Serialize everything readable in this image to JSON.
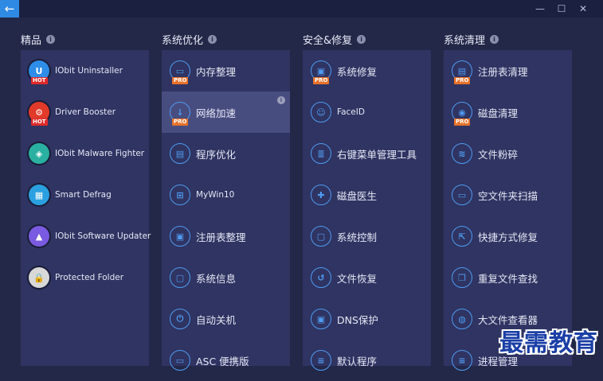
{
  "titlebar": {
    "back_glyph": "←",
    "minimize": "—",
    "maximize": "☐",
    "close": "✕"
  },
  "sections": [
    {
      "title": "精品",
      "info": "i"
    },
    {
      "title": "系统优化",
      "info": "i"
    },
    {
      "title": "安全&修复",
      "info": "i"
    },
    {
      "title": "系统清理",
      "info": "i"
    }
  ],
  "columns": [
    [
      {
        "label": "IObit Uninstaller",
        "badge": "HOT",
        "icon": "uninstaller-icon"
      },
      {
        "label": "Driver Booster",
        "badge": "HOT",
        "icon": "driver-booster-icon"
      },
      {
        "label": "IObit Malware Fighter",
        "badge": "",
        "icon": "malware-fighter-icon"
      },
      {
        "label": "Smart Defrag",
        "badge": "",
        "icon": "smart-defrag-icon"
      },
      {
        "label": "IObit Software Updater",
        "badge": "",
        "icon": "software-updater-icon"
      },
      {
        "label": "Protected Folder",
        "badge": "",
        "icon": "protected-folder-icon"
      }
    ],
    [
      {
        "label": "内存整理",
        "badge": "PRO",
        "icon": "memory-icon"
      },
      {
        "label": "网络加速",
        "badge": "PRO",
        "icon": "network-download-icon",
        "selected": true,
        "info": "i"
      },
      {
        "label": "程序优化",
        "badge": "",
        "icon": "program-optimize-icon"
      },
      {
        "label": "MyWin10",
        "badge": "",
        "icon": "windows-icon"
      },
      {
        "label": "注册表整理",
        "badge": "",
        "icon": "registry-icon"
      },
      {
        "label": "系统信息",
        "badge": "",
        "icon": "system-info-icon"
      },
      {
        "label": "自动关机",
        "badge": "",
        "icon": "power-icon"
      },
      {
        "label": "ASC 便携版",
        "badge": "",
        "icon": "portable-icon"
      }
    ],
    [
      {
        "label": "系统修复",
        "badge": "PRO",
        "icon": "system-repair-icon"
      },
      {
        "label": "FaceID",
        "badge": "",
        "icon": "faceid-icon"
      },
      {
        "label": "右键菜单管理工具",
        "badge": "",
        "icon": "context-menu-icon"
      },
      {
        "label": "磁盘医生",
        "badge": "",
        "icon": "disk-doctor-icon"
      },
      {
        "label": "系统控制",
        "badge": "",
        "icon": "system-control-icon"
      },
      {
        "label": "文件恢复",
        "badge": "",
        "icon": "file-recovery-icon"
      },
      {
        "label": "DNS保护",
        "badge": "",
        "icon": "dns-protect-icon"
      },
      {
        "label": "默认程序",
        "badge": "",
        "icon": "default-program-icon"
      }
    ],
    [
      {
        "label": "注册表清理",
        "badge": "PRO",
        "icon": "registry-clean-icon"
      },
      {
        "label": "磁盘清理",
        "badge": "PRO",
        "icon": "disk-clean-icon"
      },
      {
        "label": "文件粉碎",
        "badge": "",
        "icon": "file-shredder-icon"
      },
      {
        "label": "空文件夹扫描",
        "badge": "",
        "icon": "empty-folder-icon"
      },
      {
        "label": "快捷方式修复",
        "badge": "",
        "icon": "shortcut-fix-icon"
      },
      {
        "label": "重复文件查找",
        "badge": "",
        "icon": "duplicate-file-icon"
      },
      {
        "label": "大文件查看器",
        "badge": "",
        "icon": "large-file-icon"
      },
      {
        "label": "进程管理",
        "badge": "",
        "icon": "process-manager-icon"
      }
    ]
  ],
  "watermark": "最需教育",
  "colors": {
    "background": "#232848",
    "panel": "#2f3462",
    "selected": "#484d80",
    "accent": "#4f9af0",
    "pro": "#e8722a",
    "hot": "#e02a2a"
  }
}
